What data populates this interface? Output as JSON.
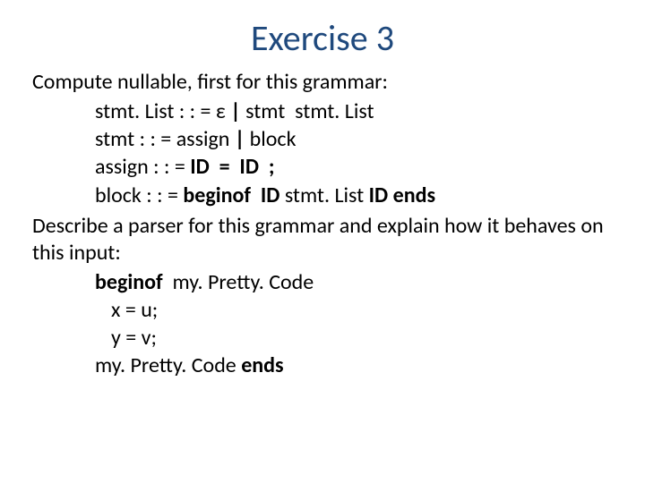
{
  "title": "Exercise 3",
  "lead": "Compute nullable, first for this grammar:",
  "rules": {
    "r1": {
      "lhs": "stmt. List",
      "op": ": : =",
      "eps": "ε",
      "bar": "|",
      "rhs_a": "stmt",
      "rhs_b": "stmt. List"
    },
    "r2": {
      "lhs": "stmt",
      "op": ": : =",
      "rhs_a": "assign",
      "bar": "|",
      "rhs_b": "block"
    },
    "r3": {
      "lhs": "assign",
      "op": ": : =",
      "id1": "ID",
      "eq": "=",
      "id2": "ID",
      "semi": ";"
    },
    "r4": {
      "lhs": "block",
      "op": ": : =",
      "begin": "beginof",
      "id": "ID",
      "mid": "stmt. List",
      "id2": "ID",
      "ends": "ends"
    }
  },
  "follow": "Describe a parser for this grammar and explain how it behaves on this input:",
  "code": {
    "c1_a": "beginof",
    "c1_b": "my. Pretty. Code",
    "c2": "x = u;",
    "c3": "y = v;",
    "c4_a": "my. Pretty. Code",
    "c4_b": "ends"
  }
}
